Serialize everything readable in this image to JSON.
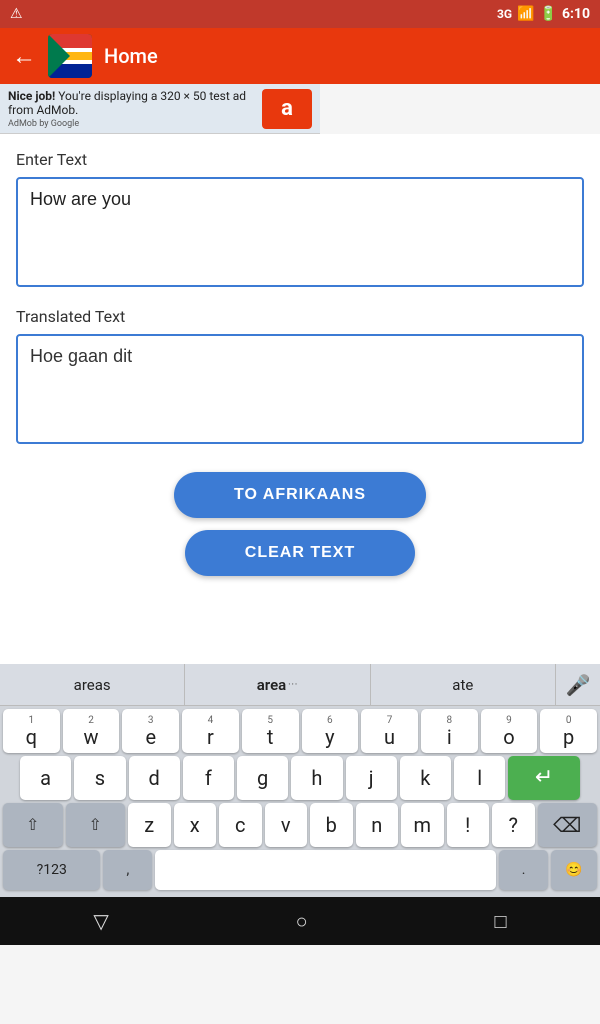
{
  "statusBar": {
    "signal": "3G",
    "battery": "🔋",
    "time": "6:10"
  },
  "appBar": {
    "title": "Home",
    "backIcon": "←"
  },
  "adBanner": {
    "boldText": "Nice job!",
    "text": " You're displaying a 320 × 50 test ad from AdMob.",
    "logoText": "a",
    "byText": "AdMob by Google"
  },
  "main": {
    "enterLabel": "Enter Text",
    "inputText": "How are you",
    "translatedLabel": "Translated Text",
    "translatedText": "Hoe gaan dit",
    "btnToAfrikaans": "TO AFRIKAANS",
    "btnClearText": "CLEAR TEXT"
  },
  "keyboard": {
    "suggestions": [
      "areas",
      "area",
      "ate"
    ],
    "micIcon": "🎤",
    "rows": [
      [
        {
          "letter": "q",
          "num": "1"
        },
        {
          "letter": "w",
          "num": "2"
        },
        {
          "letter": "e",
          "num": "3"
        },
        {
          "letter": "r",
          "num": "4"
        },
        {
          "letter": "t",
          "num": "5"
        },
        {
          "letter": "y",
          "num": "6"
        },
        {
          "letter": "u",
          "num": "7"
        },
        {
          "letter": "i",
          "num": "8"
        },
        {
          "letter": "o",
          "num": "9"
        },
        {
          "letter": "p",
          "num": "0"
        }
      ],
      [
        {
          "letter": "a"
        },
        {
          "letter": "s"
        },
        {
          "letter": "d"
        },
        {
          "letter": "f"
        },
        {
          "letter": "g"
        },
        {
          "letter": "h"
        },
        {
          "letter": "j"
        },
        {
          "letter": "k"
        },
        {
          "letter": "l"
        }
      ],
      [
        {
          "letter": "z"
        },
        {
          "letter": "x"
        },
        {
          "letter": "c"
        },
        {
          "letter": "v"
        },
        {
          "letter": "b"
        },
        {
          "letter": "n"
        },
        {
          "letter": "m"
        },
        {
          "letter": "!"
        },
        {
          "letter": "?"
        }
      ]
    ],
    "shiftIcon": "⇧",
    "backspaceIcon": "⌫",
    "enterIcon": "↵",
    "numSymLabel": "?123",
    "commaLabel": ",",
    "periodLabel": ".",
    "emojiIcon": "😊"
  },
  "navBar": {
    "backIcon": "▽",
    "homeIcon": "○",
    "recentIcon": "□"
  }
}
